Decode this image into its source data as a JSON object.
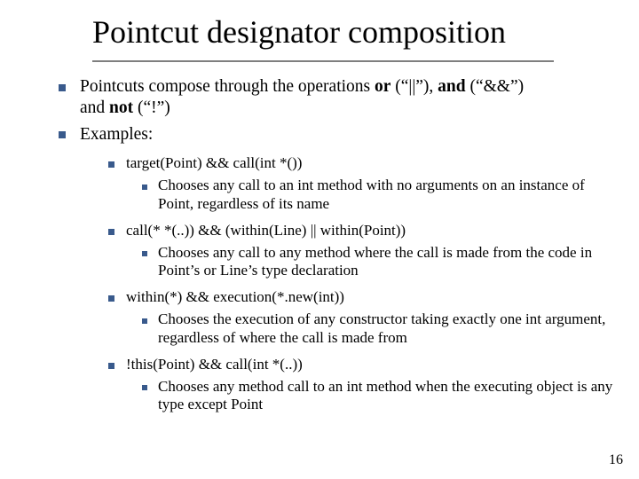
{
  "title": "Pointcut designator composition",
  "intro": {
    "line1_a": "Pointcuts compose through the operations ",
    "or": "or",
    "op_or": " (“||”), ",
    "and": "and",
    "op_and": " (“",
    "op_and_code": "&&",
    "op_and_tail": "”)",
    "line2_pre": "and ",
    "not": "not",
    "op_not": " (“",
    "op_not_code": "!",
    "op_not_tail": "”)"
  },
  "examples_label": "Examples:",
  "ex": [
    {
      "code": "target(Point) && call(int *())",
      "desc_a": "Chooses any call to an ",
      "desc_code1": "int",
      "desc_b": " method with no arguments on an instance of ",
      "desc_code2": "Point",
      "desc_c": ", regardless of its name"
    },
    {
      "code": "call(* *(..)) && (within(Line) || within(Point))",
      "desc_a": "Chooses any call to any method where the call is made from the code in ",
      "desc_code1": "Point",
      "desc_b": "’s or ",
      "desc_code2": "Line",
      "desc_c": "’s type declaration"
    },
    {
      "code": "within(*) && execution(*.new(int))",
      "desc_a": "Chooses the execution of any constructor taking exactly one ",
      "desc_code1": "int",
      "desc_b": " argument, regardless of where the call is made from",
      "desc_code2": "",
      "desc_c": ""
    },
    {
      "code": "!this(Point) && call(int *(..))",
      "desc_a": "Chooses  any method call to an ",
      "desc_code1": "int",
      "desc_b": " method when the executing object is any type except ",
      "desc_code2": "Point",
      "desc_c": ""
    }
  ],
  "page_number": "16"
}
